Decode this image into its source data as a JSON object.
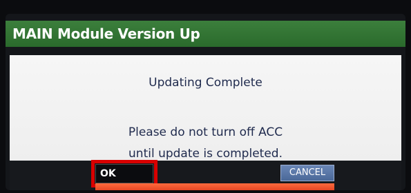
{
  "window": {
    "title": "MAIN Module Version Up"
  },
  "dialog": {
    "headline": "Updating Complete",
    "message_line1": "Please do not turn off ACC",
    "message_line2": "until update is completed."
  },
  "buttons": {
    "ok_label": "OK",
    "cancel_label": "CANCEL"
  },
  "progress": {
    "fraction": 1.0
  },
  "colors": {
    "title_bar": "#2f7a33",
    "highlight": "#d90000",
    "progress": "#ff5a2a",
    "text": "#1f2a4d"
  }
}
